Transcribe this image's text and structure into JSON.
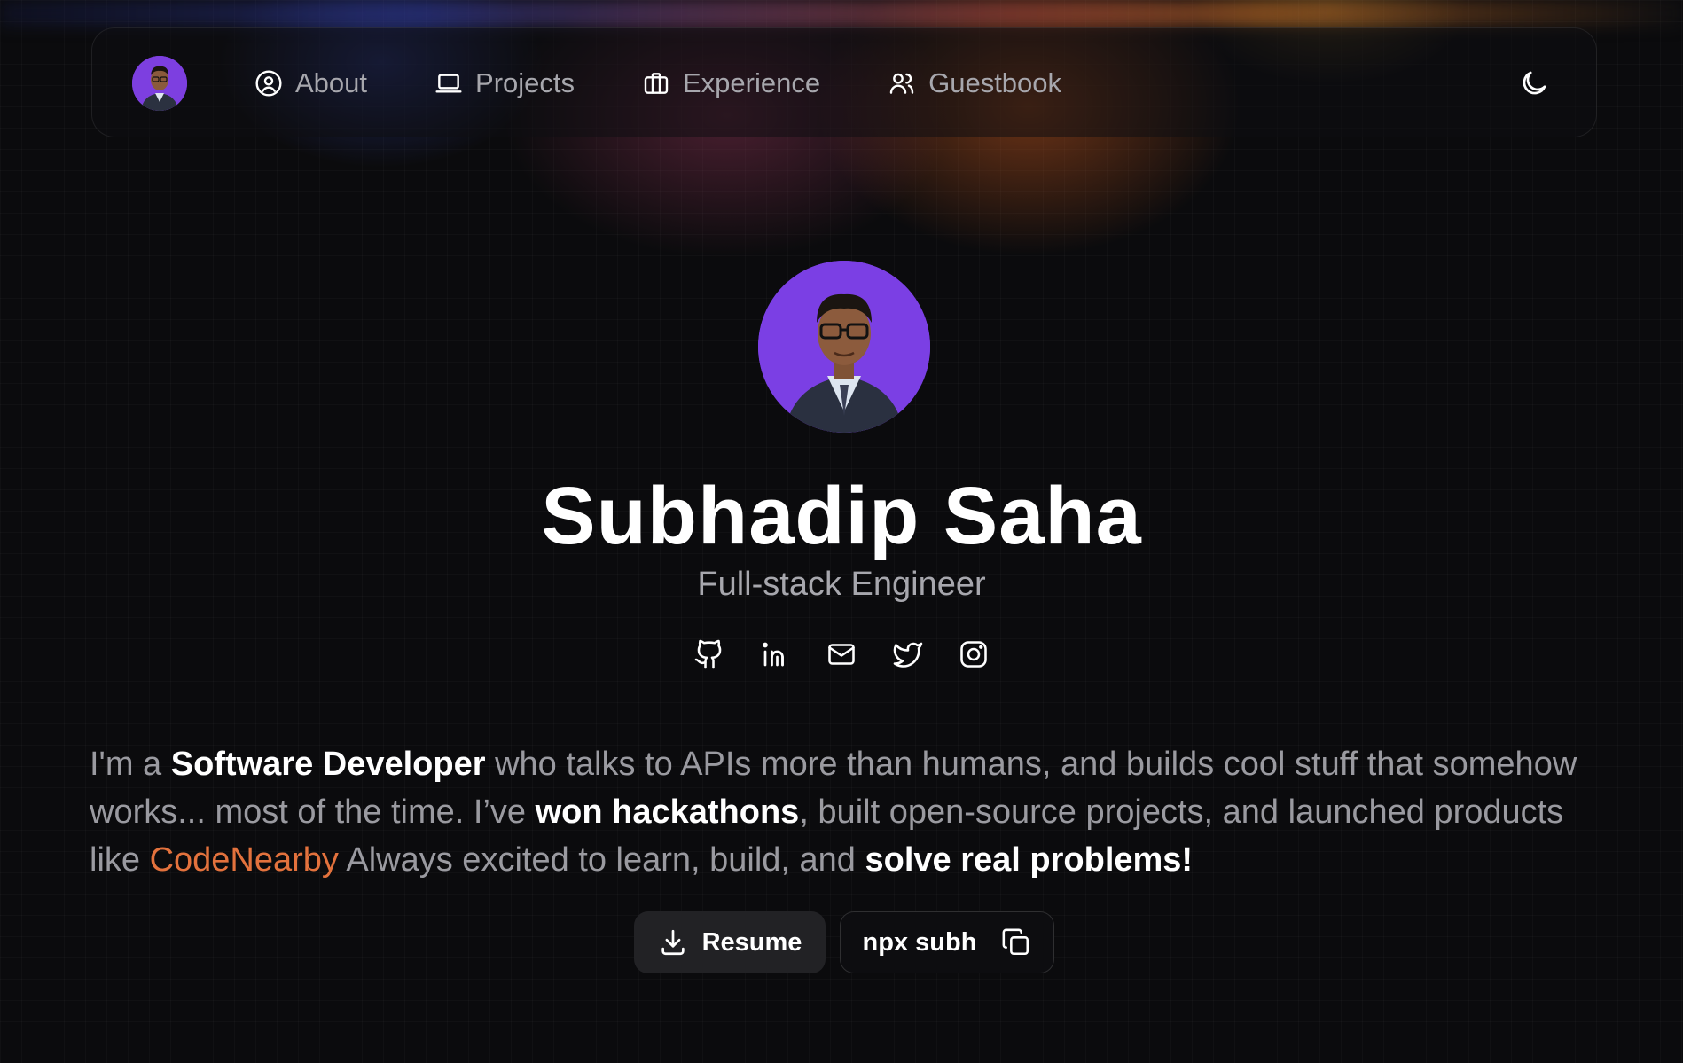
{
  "nav": {
    "avatar_alt": "profile-avatar",
    "links": [
      {
        "label": "About",
        "icon": "user-circle-icon"
      },
      {
        "label": "Projects",
        "icon": "laptop-icon"
      },
      {
        "label": "Experience",
        "icon": "briefcase-icon"
      },
      {
        "label": "Guestbook",
        "icon": "users-icon"
      }
    ],
    "theme_icon": "moon-icon"
  },
  "hero": {
    "name": "Subhadip Saha",
    "role": "Full-stack Engineer",
    "socials": [
      "github-icon",
      "linkedin-icon",
      "mail-icon",
      "twitter-icon",
      "instagram-icon"
    ]
  },
  "bio": {
    "p1": "I'm a ",
    "b1": "Software Developer",
    "p2": " who talks to APIs more than humans, and builds cool stuff that somehow works... most of the time. I’ve ",
    "b2": "won hackathons",
    "p3": ", built open-source projects, and launched products like ",
    "link": "CodeNearby",
    "p4": " Always excited to learn, build, and ",
    "b3": "solve real problems!"
  },
  "actions": {
    "resume_label": "Resume",
    "npx_label": "npx subh"
  },
  "colors": {
    "background": "#0b0b0d",
    "accent": "#e3723d",
    "avatar_bg": "#7b3fe4",
    "muted_text": "#a7a7ad"
  }
}
